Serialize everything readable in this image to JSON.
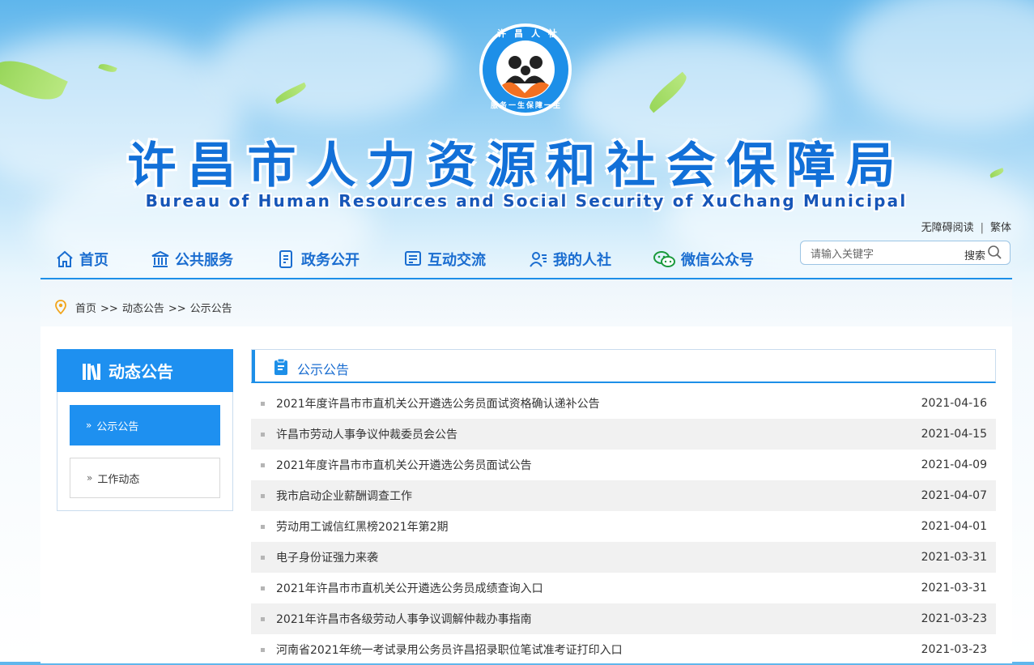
{
  "site": {
    "logo_text_top": "许昌人社",
    "logo_text_bottom": "服务一生保障一生",
    "title_cn": "许昌市人力资源和社会保障局",
    "title_en": "Bureau of Human Resources and Social Security of XuChang Municipal"
  },
  "utility": {
    "accessible": "无障碍阅读",
    "separator": "|",
    "traditional": "繁体"
  },
  "nav": [
    {
      "label": "首页",
      "icon": "home-icon"
    },
    {
      "label": "公共服务",
      "icon": "building-icon"
    },
    {
      "label": "政务公开",
      "icon": "document-icon"
    },
    {
      "label": "互动交流",
      "icon": "chat-box-icon"
    },
    {
      "label": "我的人社",
      "icon": "user-card-icon"
    },
    {
      "label": "微信公众号",
      "icon": "wechat-icon"
    }
  ],
  "search": {
    "placeholder": "请输入关键字",
    "button": "搜索"
  },
  "breadcrumb": {
    "items": [
      "首页",
      "动态公告",
      "公示公告"
    ],
    "separator": ">>"
  },
  "sidebar": {
    "title": "动态公告",
    "items": [
      {
        "label": "公示公告",
        "active": true
      },
      {
        "label": "工作动态",
        "active": false
      }
    ]
  },
  "main": {
    "title": "公示公告",
    "items": [
      {
        "title": "2021年度许昌市市直机关公开遴选公务员面试资格确认递补公告",
        "date": "2021-04-16"
      },
      {
        "title": "许昌市劳动人事争议仲裁委员会公告",
        "date": "2021-04-15"
      },
      {
        "title": "2021年度许昌市市直机关公开遴选公务员面试公告",
        "date": "2021-04-09"
      },
      {
        "title": "我市启动企业薪酬调查工作",
        "date": "2021-04-07"
      },
      {
        "title": "劳动用工诚信红黑榜2021年第2期",
        "date": "2021-04-01"
      },
      {
        "title": "电子身份证强力来袭",
        "date": "2021-03-31"
      },
      {
        "title": "2021年许昌市市直机关公开遴选公务员成绩查询入口",
        "date": "2021-03-31"
      },
      {
        "title": "2021年许昌市各级劳动人事争议调解仲裁办事指南",
        "date": "2021-03-23"
      },
      {
        "title": "河南省2021年统一考试录用公务员许昌招录职位笔试准考证打印入口",
        "date": "2021-03-23"
      }
    ]
  },
  "colors": {
    "primary": "#1e90f0",
    "nav_text": "#1a6dd0",
    "title": "#1270d8",
    "row_alt": "#f1f1f1"
  }
}
